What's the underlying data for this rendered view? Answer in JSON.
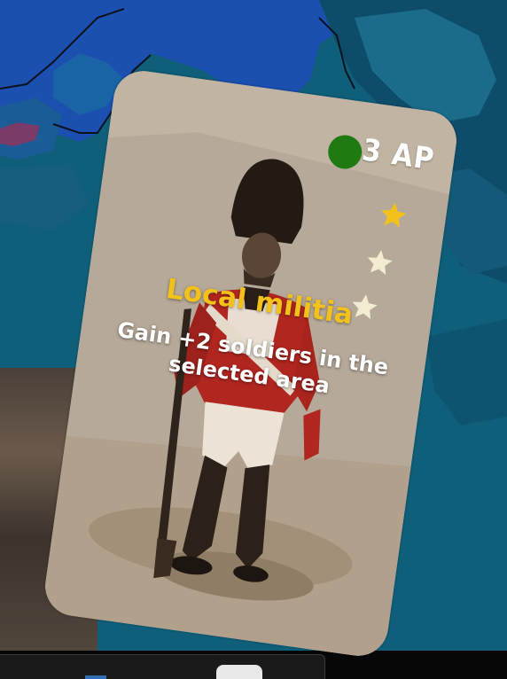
{
  "card": {
    "cost_label": "3 AP",
    "title": "Local militia",
    "description": "Gain +2 soldiers in the selected area",
    "stars": [
      {
        "state": "filled",
        "color": "#f2c21a"
      },
      {
        "state": "empty",
        "color": "#f1ecd2"
      },
      {
        "state": "empty",
        "color": "#f1ecd2"
      }
    ]
  },
  "colors": {
    "sea": "#0f5f7a",
    "land_deep": "#1b4fb0",
    "card_background": "#b7a999",
    "cost_indicator": "#1f7a12",
    "title": "#f2c21a",
    "description": "#ffffff"
  }
}
